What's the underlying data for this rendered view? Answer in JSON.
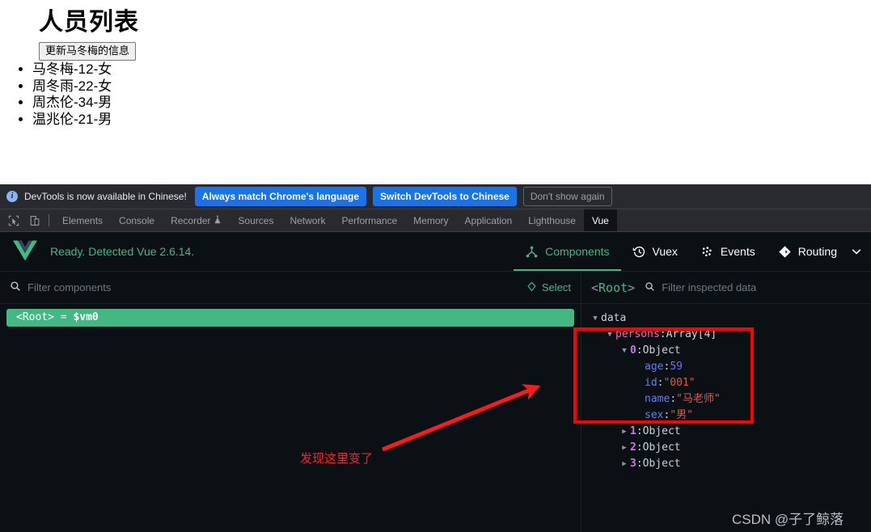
{
  "page": {
    "title": "人员列表",
    "update_button": "更新马冬梅的信息",
    "people": [
      "马冬梅-12-女",
      "周冬雨-22-女",
      "周杰伦-34-男",
      "温兆伦-21-男"
    ]
  },
  "infobar": {
    "message": "DevTools is now available in Chinese!",
    "always_match": "Always match Chrome's language",
    "switch_chinese": "Switch DevTools to Chinese",
    "dont_show": "Don't show again"
  },
  "devtools_tabs": [
    {
      "label": "Elements",
      "active": false
    },
    {
      "label": "Console",
      "active": false
    },
    {
      "label": "Recorder",
      "active": false,
      "icon": "flask-icon"
    },
    {
      "label": "Sources",
      "active": false
    },
    {
      "label": "Network",
      "active": false
    },
    {
      "label": "Performance",
      "active": false
    },
    {
      "label": "Memory",
      "active": false
    },
    {
      "label": "Application",
      "active": false
    },
    {
      "label": "Lighthouse",
      "active": false
    },
    {
      "label": "Vue",
      "active": true
    }
  ],
  "vue": {
    "status": "Ready. Detected Vue 2.6.14.",
    "nav": [
      {
        "label": "Components",
        "icon": "components-icon",
        "active": true
      },
      {
        "label": "Vuex",
        "icon": "history-clock-icon",
        "active": false
      },
      {
        "label": "Events",
        "icon": "events-dots-icon",
        "active": false
      },
      {
        "label": "Routing",
        "icon": "routing-diamond-icon",
        "active": false
      }
    ],
    "filter_components_placeholder": "Filter components",
    "select_label": "Select",
    "inspected_root": "<Root>",
    "filter_inspected_placeholder": "Filter inspected data",
    "tree": {
      "root_tag": "<Root>",
      "root_eq": "=",
      "root_vm": "$vm0"
    },
    "data_tree": [
      {
        "indent": 0,
        "caret": "open",
        "key": "data",
        "key_style": "group",
        "value": "",
        "value_style": "none"
      },
      {
        "indent": 1,
        "caret": "open",
        "key": "persons",
        "key_style": "pink",
        "value": "Array[4]",
        "value_style": "plain"
      },
      {
        "indent": 2,
        "caret": "open",
        "key": "0",
        "key_style": "index",
        "value": "Object",
        "value_style": "plain"
      },
      {
        "indent": 3,
        "caret": "none",
        "key": "age",
        "key_style": "blue",
        "value": "59",
        "value_style": "number"
      },
      {
        "indent": 3,
        "caret": "none",
        "key": "id",
        "key_style": "blue",
        "value": "\"001\"",
        "value_style": "string"
      },
      {
        "indent": 3,
        "caret": "none",
        "key": "name",
        "key_style": "blue",
        "value": "\"马老师\"",
        "value_style": "string"
      },
      {
        "indent": 3,
        "caret": "none",
        "key": "sex",
        "key_style": "blue",
        "value": "\"男\"",
        "value_style": "string"
      },
      {
        "indent": 2,
        "caret": "closed",
        "key": "1",
        "key_style": "index",
        "value": "Object",
        "value_style": "plain"
      },
      {
        "indent": 2,
        "caret": "closed",
        "key": "2",
        "key_style": "index",
        "value": "Object",
        "value_style": "plain"
      },
      {
        "indent": 2,
        "caret": "closed",
        "key": "3",
        "key_style": "index",
        "value": "Object",
        "value_style": "plain"
      }
    ]
  },
  "annotations": {
    "arrow_note": "发现这里变了",
    "highlight_color": "#ff0000",
    "watermark": "CSDN @子了鲸落"
  }
}
